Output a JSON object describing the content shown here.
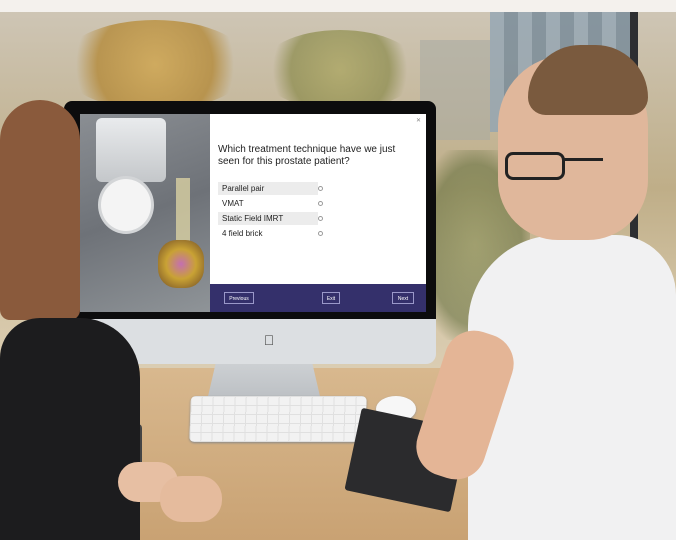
{
  "screen": {
    "question": "Which treatment technique have we just seen for this prostate patient?",
    "options": [
      "Parallel pair",
      "VMAT",
      "Static Field IMRT",
      "4 field brick"
    ],
    "buttons": {
      "previous": "Previous",
      "exit": "Exit",
      "next": "Next"
    },
    "close_icon": "close-icon",
    "accent_color": "#34306b"
  },
  "logo": {
    "icon": "apple-logo"
  }
}
